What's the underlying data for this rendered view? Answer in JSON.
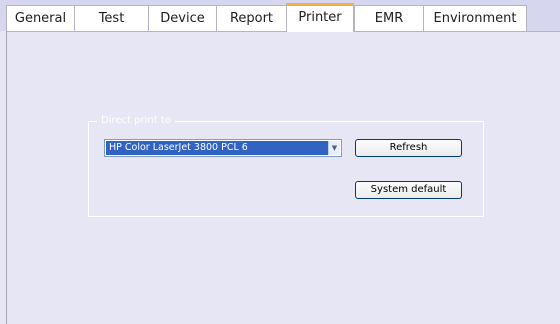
{
  "tabs": [
    {
      "label": "General"
    },
    {
      "label": "Test"
    },
    {
      "label": "Device"
    },
    {
      "label": "Report"
    },
    {
      "label": "Printer"
    },
    {
      "label": "EMR"
    },
    {
      "label": "Environment"
    }
  ],
  "active_tab": "Printer",
  "printer_group": {
    "legend": "Direct print to",
    "selected_printer": "HP Color LaserJet 3800 PCL 6",
    "refresh_label": "Refresh",
    "system_default_label": "System default"
  },
  "colors": {
    "selection": "#3163c5",
    "active_tab_accent": "#f0b040",
    "panel_background": "#e6e6f4"
  },
  "icons": {
    "dropdown": "chevron-down-icon"
  }
}
